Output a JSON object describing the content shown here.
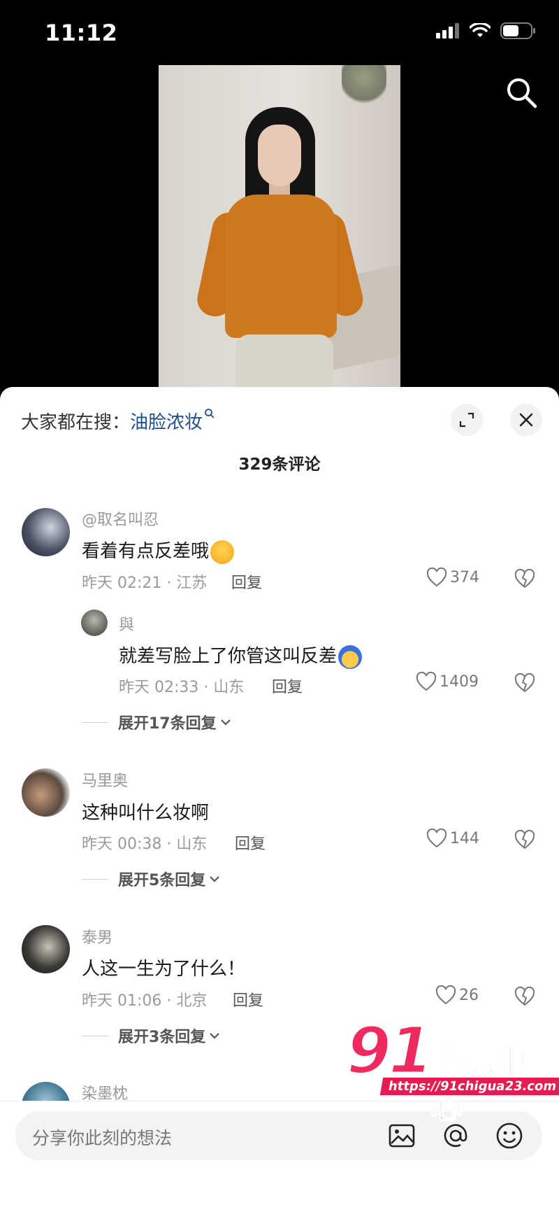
{
  "status_bar": {
    "time": "11:12"
  },
  "search_hint": {
    "prefix": "大家都在搜：",
    "keyword": "油脸浓妆"
  },
  "comments_count": "329条评论",
  "comments": [
    {
      "name": "@取名叫忍",
      "text": "看着有点反差哦",
      "meta": "昨天 02:21 · 江苏",
      "reply_label": "回复",
      "likes": "374",
      "sub": {
        "name": "與",
        "text": "就差写脸上了你管这叫反差",
        "meta": "昨天 02:33 · 山东",
        "reply_label": "回复",
        "likes": "1409"
      },
      "expand_label": "展开17条回复"
    },
    {
      "name": "马里奥",
      "text": "这种叫什么妆啊",
      "meta": "昨天 00:38 · 山东",
      "reply_label": "回复",
      "likes": "144",
      "expand_label": "展开5条回复"
    },
    {
      "name": "泰男",
      "text": "人这一生为了什么！",
      "meta": "昨天 01:06 · 北京",
      "reply_label": "回复",
      "likes": "26",
      "expand_label": "展开3条回复"
    },
    {
      "name": "染墨枕"
    }
  ],
  "input": {
    "placeholder": "分享你此刻的想法"
  },
  "watermark": {
    "number": "91",
    "name": "吃瓜中心",
    "url": "https://91chigua23.com"
  },
  "colors": {
    "accent_blue": "#1f4f8f",
    "watermark_red": "#ee2a5f"
  }
}
